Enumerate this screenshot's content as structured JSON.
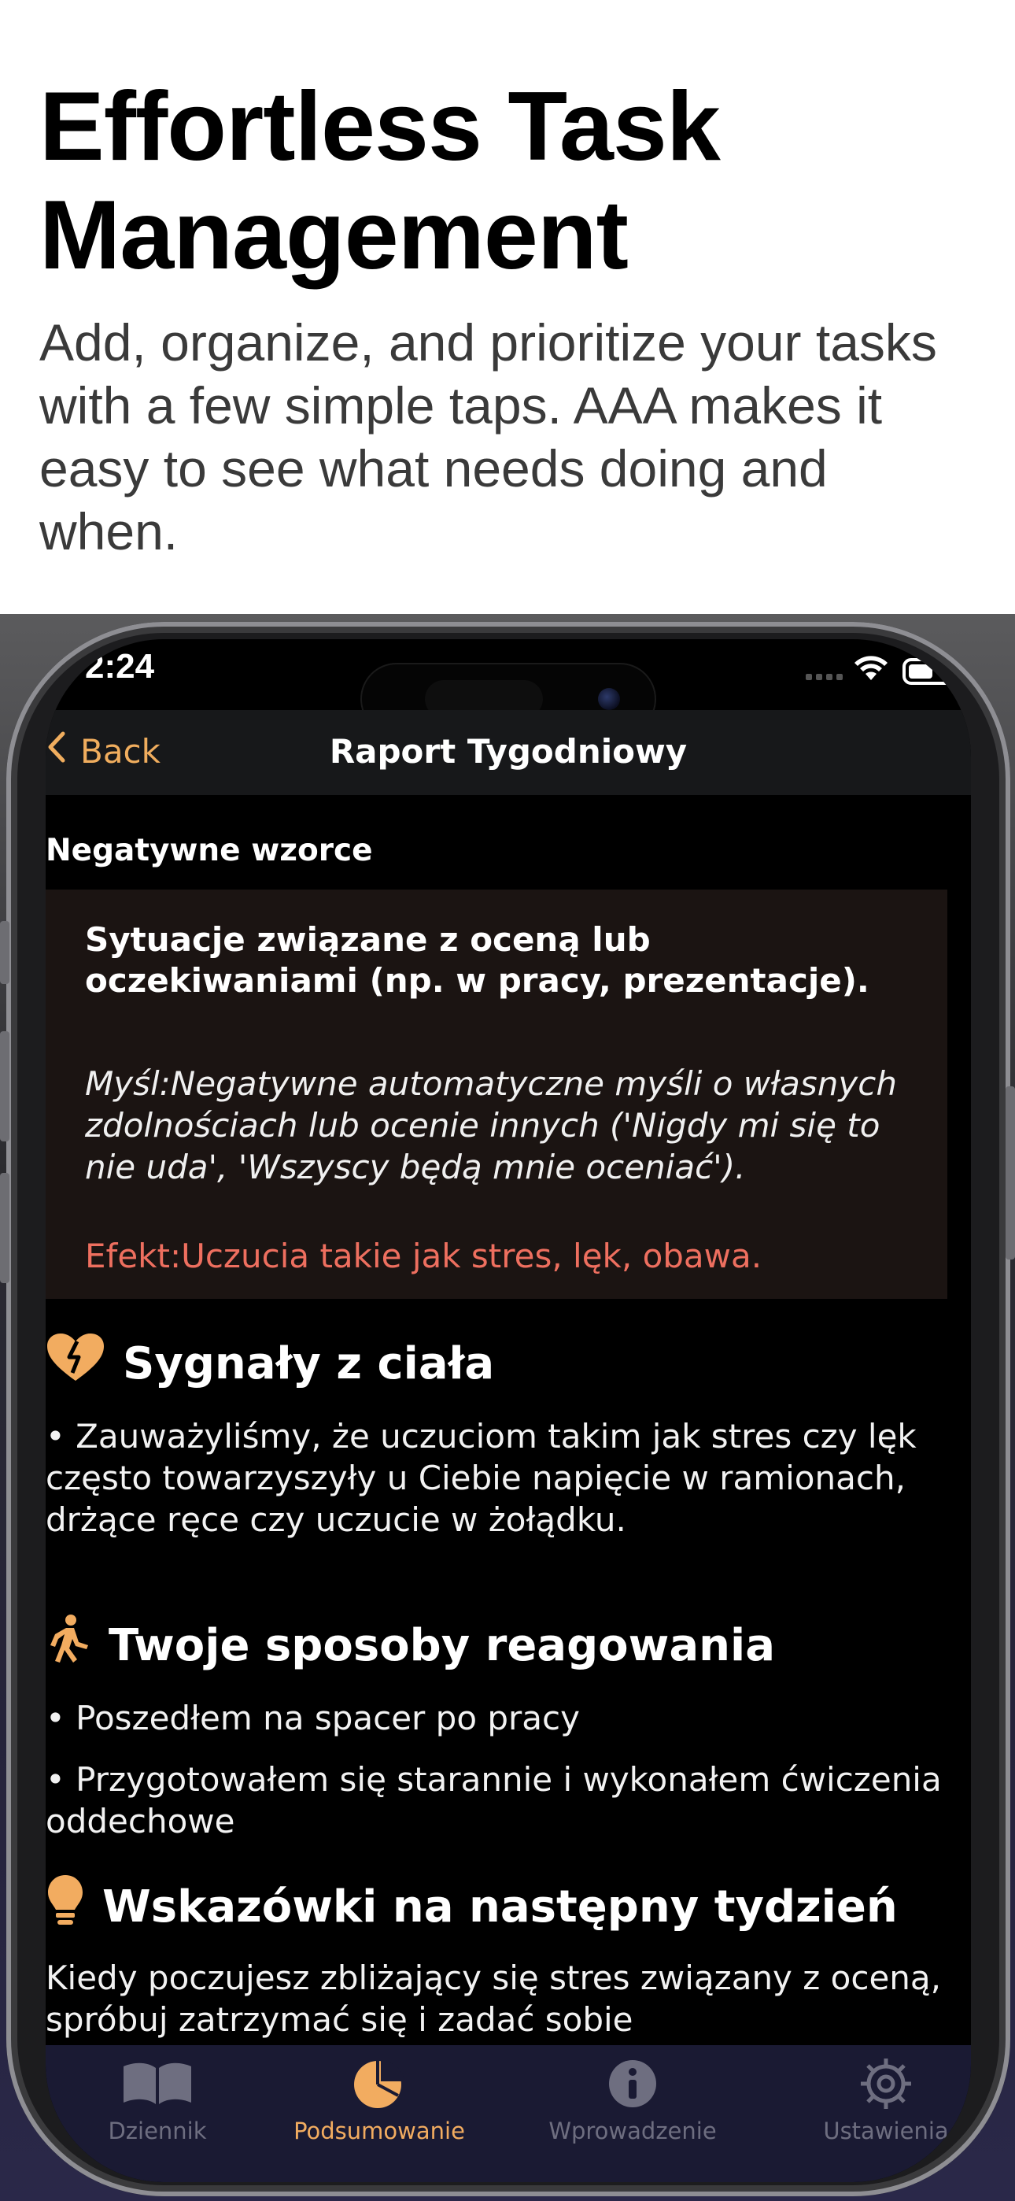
{
  "hero": {
    "title": "Effortless Task\nManagement",
    "subtitle": "Add, organize, and prioritize your tasks with a few simple taps. AAA makes it easy to see what needs doing and when."
  },
  "status_bar": {
    "time": "2:24",
    "icons": [
      "signal-icon",
      "wifi-icon",
      "battery-icon"
    ]
  },
  "nav": {
    "back_label": "Back",
    "title": "Raport Tygodniowy"
  },
  "negative_patterns": {
    "caption": "Negatywne wzorce",
    "situation": "Sytuacje związane z oceną lub oczekiwaniami (np. w pracy, prezentacje).",
    "thought": "Myśl:Negatywne automatyczne myśli o własnych zdolnościach lub ocenie innych ('Nigdy mi się to nie uda', 'Wszyscy będą mnie oceniać').",
    "effect": "Efekt:Uczucia takie jak stres, lęk, obawa."
  },
  "body_signals": {
    "title": "Sygnały z ciała",
    "text": "• Zauważyliśmy, że uczuciom takim jak stres czy lęk często towarzyszyły u Ciebie napięcie w ramionach, drżące ręce czy uczucie w żołądku."
  },
  "reactions": {
    "title": "Twoje sposoby reagowania",
    "items": [
      "• Poszedłem na spacer po pracy",
      "• Przygotowałem się starannie i wykonałem ćwiczenia oddechowe"
    ]
  },
  "tips": {
    "title": "Wskazówki na następny tydzień",
    "text": "Kiedy poczujesz zbliżający się stres związany z oceną, spróbuj zatrzymać się i zadać sobie"
  },
  "tabs": [
    {
      "label": "Dziennik",
      "icon": "book-icon",
      "active": false
    },
    {
      "label": "Podsumowanie",
      "icon": "pie-chart-icon",
      "active": true
    },
    {
      "label": "Wprowadzenie",
      "icon": "info-icon",
      "active": false
    },
    {
      "label": "Ustawienia",
      "icon": "gear-icon",
      "active": false
    }
  ],
  "colors": {
    "accent": "#f2ac60",
    "effect_text": "#ee6f5f",
    "card_background": "#1b1412",
    "tabbar_background": "#1a1a33"
  }
}
